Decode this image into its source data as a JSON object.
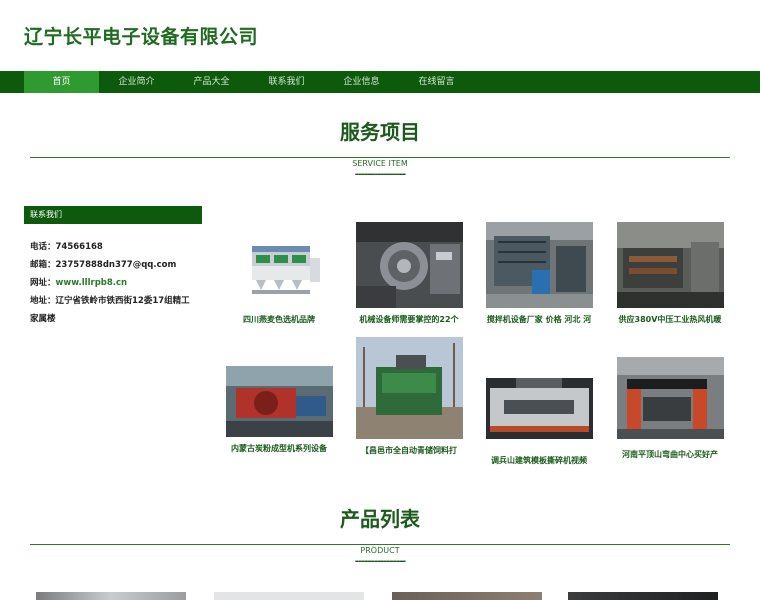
{
  "header": {
    "title": "辽宁长平电子设备有限公司"
  },
  "nav": {
    "items": [
      {
        "label": "首页"
      },
      {
        "label": "企业简介"
      },
      {
        "label": "产品大全"
      },
      {
        "label": "联系我们"
      },
      {
        "label": "企业信息"
      },
      {
        "label": "在线留言"
      }
    ]
  },
  "services": {
    "title": "服务项目",
    "subtitle": "SERVICE ITEM",
    "divider": "----------------"
  },
  "contact": {
    "heading": "联系我们",
    "phone_label": "电话：",
    "phone": "74566168",
    "email_label": "邮箱：",
    "email": "23757888dn377@qq.com",
    "web_label": "网址：",
    "web": "www.lllrpb8.cn",
    "address_label": "地址：",
    "address": "辽宁省铁岭市铁西街12委17组精工家属楼"
  },
  "items": [
    {
      "caption": "四川燕麦色选机品牌",
      "icon": "color-sorter-machine"
    },
    {
      "caption": "机械设备师需要掌控的22个",
      "icon": "industrial-machine"
    },
    {
      "caption": "搅拌机设备厂家 价格 河北 河",
      "icon": "mixer-plant"
    },
    {
      "caption": "供应380V中压工业热风机暖",
      "icon": "factory-workshop"
    },
    {
      "caption": "内蒙古炭粉成型机系列设备",
      "icon": "briquette-machine"
    },
    {
      "caption": "【昌邑市全自动青储饲料打",
      "icon": "silage-baler"
    },
    {
      "caption": "调兵山建筑模板撕碎机视频",
      "icon": "shredder"
    },
    {
      "caption": "河南平顶山弯曲中心买好产",
      "icon": "bending-center"
    }
  ],
  "products": {
    "title": "产品列表",
    "subtitle": "PRODUCT",
    "divider": "----------------"
  },
  "colors": {
    "brand": "#0d5a0d",
    "accent": "#2f9a2f",
    "title": "#1f6b1f"
  }
}
